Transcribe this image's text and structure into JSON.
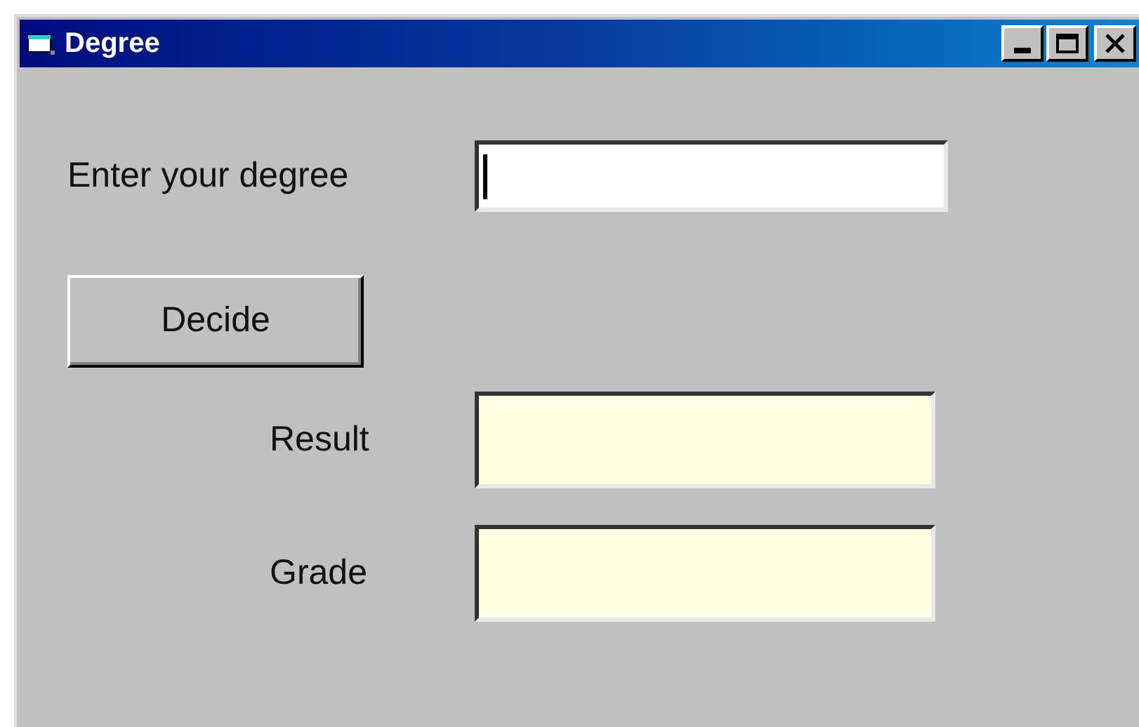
{
  "window": {
    "title": "Degree"
  },
  "input": {
    "label": "Enter your degree",
    "focused": true
  },
  "button": {
    "label": "Decide"
  },
  "outputs": [
    {
      "label": "Result"
    },
    {
      "label": "Grade"
    }
  ]
}
